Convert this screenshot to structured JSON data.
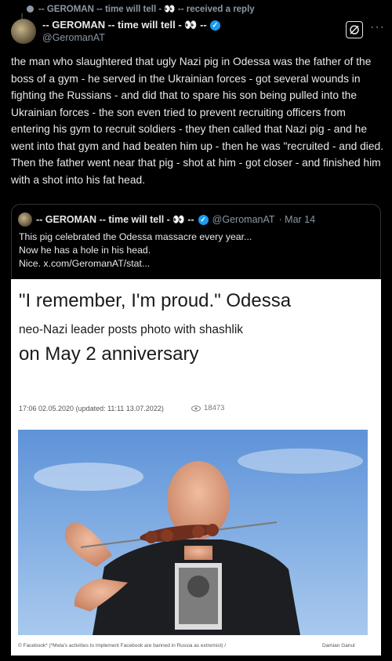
{
  "reply_context": {
    "text": "-- GEROMAN -- time will tell - 👀 -- received a reply"
  },
  "author": {
    "display_name": "-- GEROMAN -- time will tell - 👀 --",
    "handle": "@GeromanAT"
  },
  "tweet": {
    "paragraph1": "the man who slaughtered that ugly Nazi pig in Odessa was the father of the boss of a gym - he served in the Ukrainian forces - got several wounds in fighting the Russians - and did that to spare his son being pulled into the Ukrainian forces - the son even tried to prevent recruiting officers from entering his gym to recruit soldiers - they then called that Nazi pig - and he went into that gym and had beaten him up - then he was \"recruited - and died.",
    "paragraph2": "Then the father went near that pig - shot at him - got closer - and finished him with a shot into his fat head."
  },
  "quote": {
    "display_name": "-- GEROMAN -- time will tell - 👀 --",
    "handle": "@GeromanAT",
    "date": "· Mar 14",
    "line1": "This pig celebrated the Odessa massacre every year...",
    "line2": "Now he has a hole in his head.",
    "line3": "Nice.  x.com/GeromanAT/stat..."
  },
  "article": {
    "headline1": "\"I remember, I'm proud.\" Odessa",
    "headline2": "neo-Nazi leader posts photo with shashlik",
    "headline3": "on May 2 anniversary",
    "meta": "17:06 02.05.2020 (updated: 11:11 13.07.2022)",
    "views": "18473",
    "caption": "© Facebook* (*Meta's activities to implement Facebook are banned in Russia as extremist) /",
    "credit": "Damian Ganul"
  },
  "colors": {
    "background": "#000000",
    "text": "#e7e9ea",
    "secondary_text": "#8b98a5",
    "verified_badge": "#1d9bf0"
  }
}
